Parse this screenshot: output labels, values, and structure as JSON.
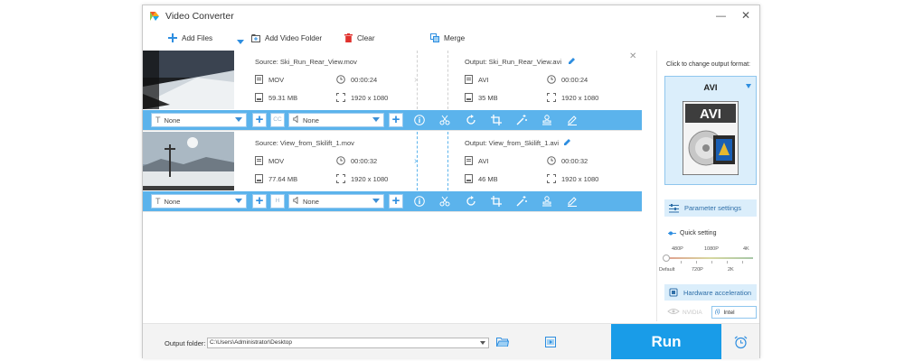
{
  "window": {
    "title": "Video Converter",
    "minimize_label": "—",
    "close_label": "✕"
  },
  "toolbar": {
    "add_files": "Add Files",
    "add_folder": "Add Video Folder",
    "clear": "Clear",
    "merge": "Merge"
  },
  "tasks": [
    {
      "source_title": "Source: Ski_Run_Rear_View.mov",
      "source_format": "MOV",
      "source_duration": "00:00:24",
      "source_size": "59.31 MB",
      "source_resolution": "1920 x 1080",
      "output_title": "Output: Ski_Run_Rear_View.avi",
      "output_format": "AVI",
      "output_duration": "00:00:24",
      "output_size": "35 MB",
      "output_resolution": "1920 x 1080",
      "subtitle": "None",
      "audio": "None",
      "subtitle_toggle": "CC"
    },
    {
      "source_title": "Source: View_from_Skilift_1.mov",
      "source_format": "MOV",
      "source_duration": "00:00:32",
      "source_size": "77.64 MB",
      "source_resolution": "1920 x 1080",
      "output_title": "Output: View_from_Skilift_1.avi",
      "output_format": "AVI",
      "output_duration": "00:00:32",
      "output_size": "46 MB",
      "output_resolution": "1920 x 1080",
      "subtitle": "None",
      "audio": "None",
      "subtitle_toggle": "H"
    }
  ],
  "right_panel": {
    "change_label": "Click to change output format:",
    "format": "AVI",
    "format_badge": "AVI",
    "parameter_settings": "Parameter settings",
    "quick_setting": "Quick setting",
    "quality_top": [
      "480P",
      "1080P",
      "4K"
    ],
    "quality_bottom": [
      "Default",
      "720P",
      "2K"
    ],
    "hardware_acceleration": "Hardware acceleration",
    "gpu_nvidia": "NVIDIA",
    "gpu_intel": "Intel"
  },
  "bottom": {
    "output_folder_label": "Output folder:",
    "output_folder_path": "C:\\Users\\Administrator\\Desktop",
    "run_label": "Run"
  },
  "colors": {
    "accent": "#199ce8",
    "edit_bar": "#5bb3ec",
    "panel_highlight": "#dbeefb",
    "clear_icon": "#e0312d"
  }
}
